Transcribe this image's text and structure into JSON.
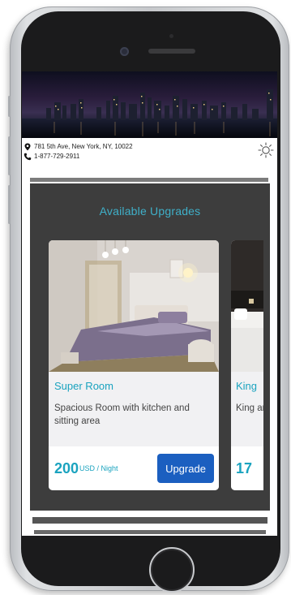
{
  "header": {
    "address": "781 5th Ave, New York, NY, 10022",
    "phone": "1-877-729-2911"
  },
  "icons": {
    "address": "location-pin-icon",
    "phone": "phone-icon",
    "theme": "sun-icon"
  },
  "upgrades": {
    "title": "Available Upgrades",
    "rooms": [
      {
        "name": "Super Room",
        "description": "Spacious Room with kitchen and sitting area",
        "price": "200",
        "unit": "USD / Night",
        "button": "Upgrade"
      },
      {
        "name": "King",
        "description": "King area",
        "price": "17",
        "unit": "",
        "button": ""
      }
    ]
  },
  "colors": {
    "accent": "#1aa3bf",
    "button": "#1b5fc0",
    "panel": "#3d3d3d"
  }
}
